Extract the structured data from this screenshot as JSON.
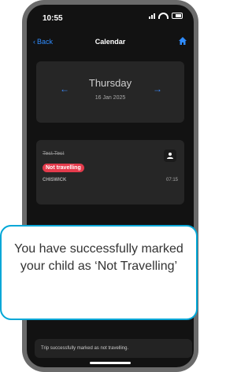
{
  "status": {
    "time": "10:55"
  },
  "nav": {
    "back_label": "Back",
    "title": "Calendar"
  },
  "day": {
    "name": "Thursday",
    "date": "16 Jan 2025"
  },
  "trip": {
    "child_name": "Test Test",
    "status_badge": "Not travelling",
    "route": "CHISWICK",
    "time": "07:15"
  },
  "overlay": {
    "message": "You have successfully marked your child as ‘Not Travelling’"
  },
  "toast": {
    "message": "Trip successfully marked as not travelling."
  },
  "colors": {
    "accent": "#2f8cff",
    "danger": "#e43b4c",
    "callout_border": "#00a7d7"
  },
  "icons": {
    "back": "chevron-left-icon",
    "home": "home-icon",
    "prev": "arrow-left-icon",
    "next": "arrow-right-icon",
    "person": "person-add-icon"
  }
}
